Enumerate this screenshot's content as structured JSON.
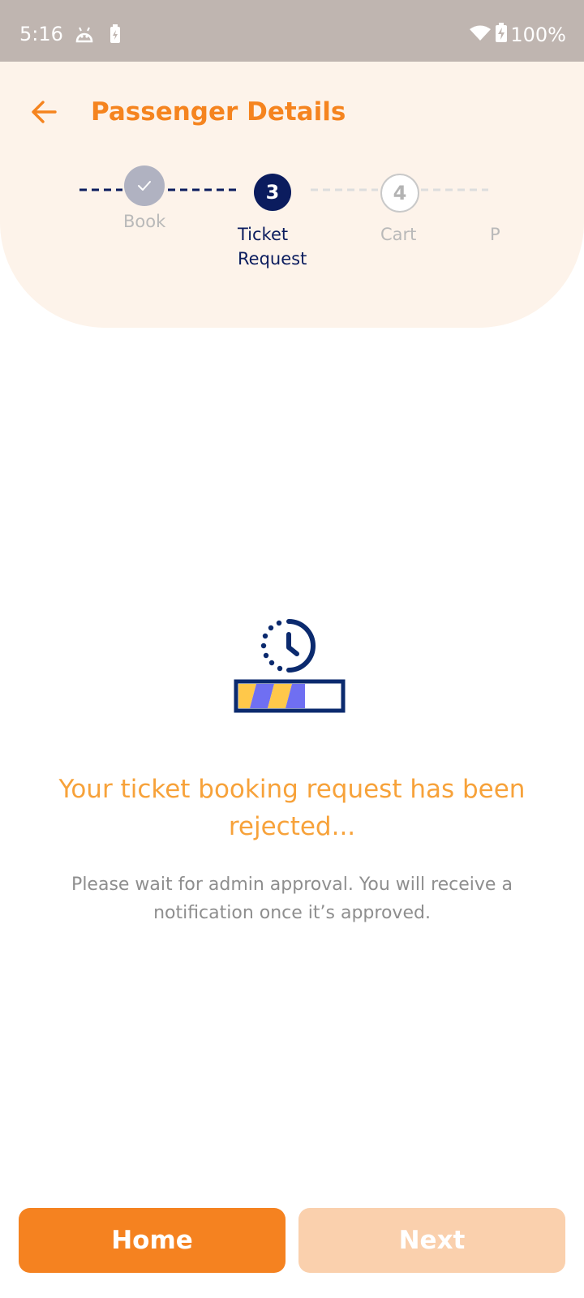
{
  "status_bar": {
    "time": "5:16",
    "battery_percent": "100%",
    "icons": [
      "android-icon",
      "battery-saver-icon",
      "wifi-icon",
      "battery-charging-icon"
    ]
  },
  "header": {
    "title": "Passenger Details",
    "back_icon": "arrow-left-icon",
    "accent_color": "#f5841f",
    "background_color": "#fdf3ea"
  },
  "stepper": {
    "steps": [
      {
        "number": "",
        "label": "Book",
        "state": "completed",
        "icon": "check-icon"
      },
      {
        "number": "3",
        "label": "Ticket Request",
        "state": "active"
      },
      {
        "number": "4",
        "label": "Cart",
        "state": "pending"
      },
      {
        "number": "",
        "label": "P",
        "state": "pending"
      }
    ],
    "active_color": "#0b1c5e"
  },
  "message": {
    "icon": "pending-approval-clock-icon",
    "headline": "Your ticket booking request has been rejected...",
    "body": "Please wait for admin approval. You will receive a notification once it’s approved.",
    "headline_color": "#f7a23a"
  },
  "buttons": {
    "home_label": "Home",
    "next_label": "Next",
    "primary_color": "#f58220",
    "disabled_color": "#fad0ad"
  }
}
